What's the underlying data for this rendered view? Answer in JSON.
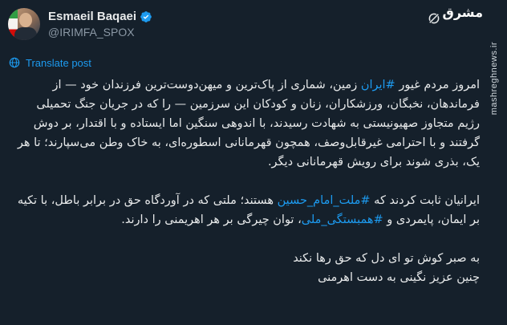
{
  "post": {
    "author": {
      "display_name": "Esmaeil Baqaei",
      "handle": "@IRIMFA_SPOX",
      "verified": true
    },
    "translate_label": "Translate post",
    "paragraph1": {
      "before": "امروز مردم غیور ",
      "hashtag": "#ایران",
      "after": " زمین، شماری از پاک‌ترین و میهن‌دوست‌ترین فرزندان خود — از فرماندهان، نخبگان، ورزشکاران، زنان و کودکان این سرزمین — را که در جریان جنگ تحمیلی رژیم متجاوز صهیونیستی به شهادت رسیدند، با اندوهی سنگین اما ایستاده و با اقتدار، بر دوش گرفتند و با احترامی غیرقابل‌وصف، همچون قهرمانانی اسطوره‌ای، به خاک وطن می‌سپارند؛ تا هر یک، بذری شوند برای رویش قهرمانانی دیگر."
    },
    "paragraph2": {
      "part1": "ایرانیان ثابت کردند که ",
      "hashtag1": "#ملت_امام_حسین",
      "part2": " هستند؛ ملتی که در آوردگاه حق در برابر باطل، با تکیه بر ایمان، پایمردی و ",
      "hashtag2": "#همبستگی_ملی",
      "part3": "، توان چیرگی بر هر اهریمنی را دارند."
    },
    "poem": {
      "line1": "به صبر کوش تو ای دل که حق رها نکند",
      "line2": "چنین عزیز نگینی به دست اهرمنی"
    }
  },
  "branding": {
    "logo_text": "مشرق",
    "watermark": "mashreghnews.ir"
  },
  "icons": {
    "verified": "verified-badge-icon",
    "grok": "grok-icon",
    "translate": "globe-icon"
  },
  "colors": {
    "background": "#15202b",
    "text": "#e7e9ea",
    "secondary_text": "#8b98a5",
    "accent": "#1d9bf0"
  }
}
